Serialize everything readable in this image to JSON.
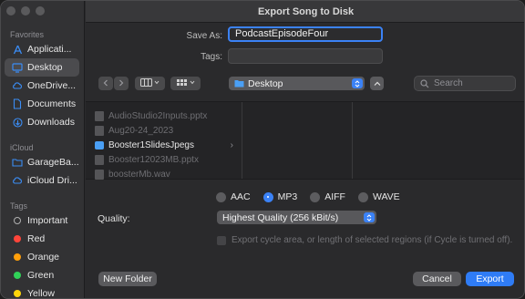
{
  "window": {
    "title": "Export Song to Disk"
  },
  "sidebar": {
    "favorites_header": "Favorites",
    "favorites": [
      {
        "label": "Applicati...",
        "icon": "applications-icon"
      },
      {
        "label": "Desktop",
        "icon": "desktop-icon",
        "selected": true
      },
      {
        "label": "OneDrive...",
        "icon": "cloud-icon"
      },
      {
        "label": "Documents",
        "icon": "document-icon"
      },
      {
        "label": "Downloads",
        "icon": "download-icon"
      }
    ],
    "icloud_header": "iCloud",
    "icloud": [
      {
        "label": "GarageBa...",
        "icon": "folder-icon"
      },
      {
        "label": "iCloud Dri...",
        "icon": "cloud-icon"
      }
    ],
    "tags_header": "Tags",
    "tags": [
      {
        "label": "Important",
        "color": "#1e1e1e",
        "hollow": true
      },
      {
        "label": "Red",
        "color": "#ff453a"
      },
      {
        "label": "Orange",
        "color": "#ff9f0a"
      },
      {
        "label": "Green",
        "color": "#30d158"
      },
      {
        "label": "Yellow",
        "color": "#ffd60a"
      }
    ]
  },
  "form": {
    "save_as_label": "Save As:",
    "save_as_value": "PodcastEpisodeFour",
    "tags_label": "Tags:",
    "tags_value": ""
  },
  "toolbar": {
    "location": "Desktop",
    "search_placeholder": "Search"
  },
  "browser": {
    "files": [
      {
        "name": "AudioStudio2Inputs.pptx",
        "type": "file"
      },
      {
        "name": "Aug20-24_2023",
        "type": "file"
      },
      {
        "name": "Booster1SlidesJpegs",
        "type": "folder"
      },
      {
        "name": "Booster12023MB.pptx",
        "type": "file"
      },
      {
        "name": "boosterMb.wav",
        "type": "file"
      }
    ]
  },
  "format": {
    "options": [
      "AAC",
      "MP3",
      "AIFF",
      "WAVE"
    ],
    "selected": "MP3"
  },
  "quality": {
    "label": "Quality:",
    "value": "Highest Quality (256 kBit/s)"
  },
  "export_cycle_label": "Export cycle area, or length of selected regions (if Cycle is turned off).",
  "buttons": {
    "new_folder": "New Folder",
    "cancel": "Cancel",
    "export": "Export"
  },
  "colors": {
    "accent": "#2f7cf6"
  }
}
